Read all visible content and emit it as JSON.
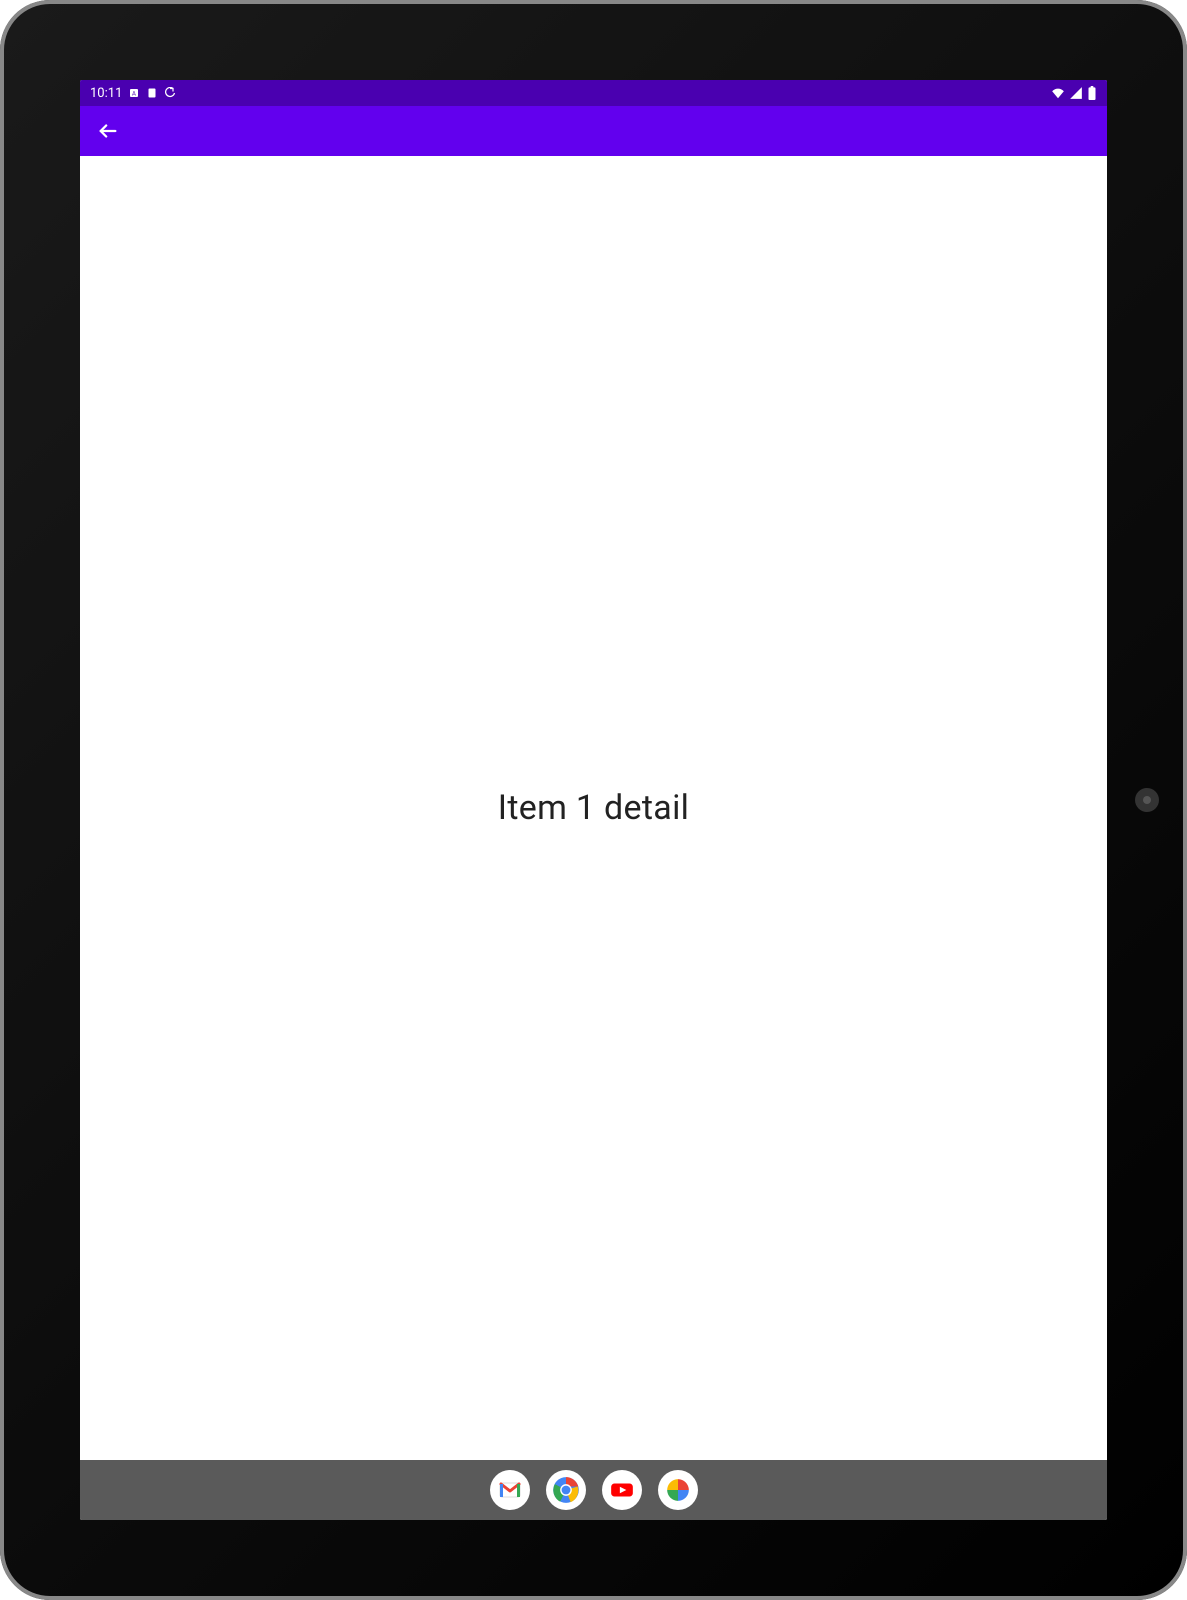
{
  "status_bar": {
    "time": "10:11",
    "left_icons": [
      "auto-rotate-icon",
      "card-icon",
      "sync-icon"
    ],
    "right_icons": [
      "wifi-icon",
      "signal-icon",
      "battery-icon"
    ]
  },
  "app_bar": {
    "back_label": "Back"
  },
  "main": {
    "text": "Item 1 detail"
  },
  "dock": {
    "apps": [
      {
        "name": "gmail",
        "label": "Gmail"
      },
      {
        "name": "chrome",
        "label": "Chrome"
      },
      {
        "name": "youtube",
        "label": "YouTube"
      },
      {
        "name": "photos",
        "label": "Photos"
      }
    ]
  },
  "colors": {
    "status_dark": "#4a00b0",
    "app_bar": "#6200ee",
    "nav_bar": "#5a5a5a"
  }
}
